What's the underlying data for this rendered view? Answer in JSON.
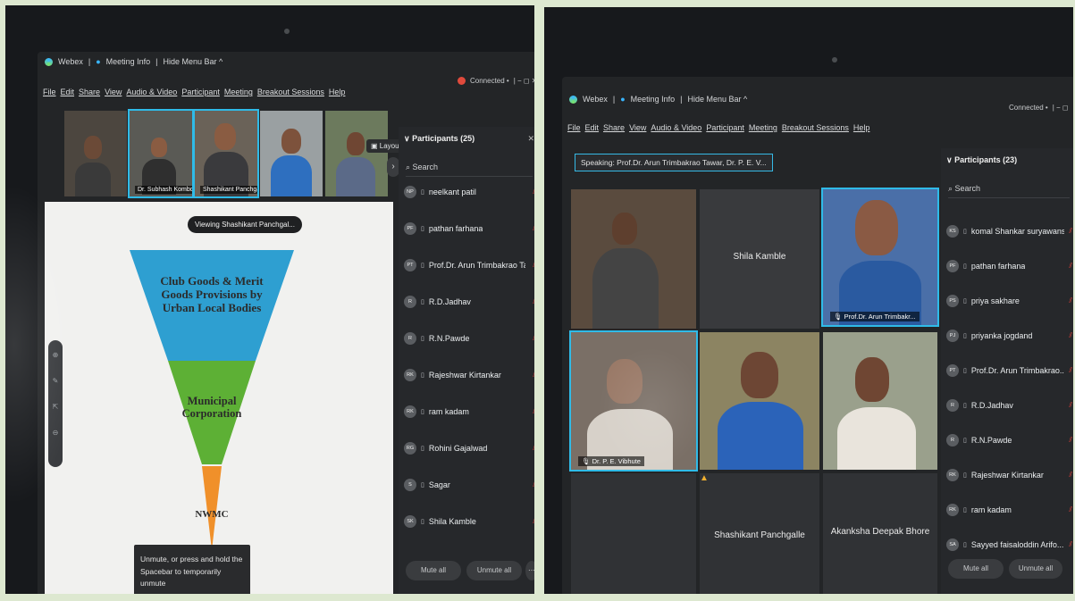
{
  "left": {
    "titlebar": {
      "app_name": "Webex",
      "meeting_info": "Meeting Info",
      "hide_menu_bar": "Hide Menu Bar ^"
    },
    "connection": {
      "status": "Connected •",
      "controls": "| − ◻ ✕"
    },
    "menu": [
      "File",
      "Edit",
      "Share",
      "View",
      "Audio & Video",
      "Participant",
      "Meeting",
      "Breakout Sessions",
      "Help"
    ],
    "filmstrip": [
      {
        "name": ""
      },
      {
        "name": "Dr. Subhash Kombde"
      },
      {
        "name": "Shashikant Panchgalle"
      },
      {
        "name": ""
      },
      {
        "name": ""
      }
    ],
    "layout_label": "Layout",
    "viewing_label": "Viewing Shashikant Panchgal...",
    "pyramid": {
      "top": "Club Goods & Merit Goods Provisions by Urban Local Bodies",
      "middle": "Municipal Corporation",
      "bottom": "NWMC",
      "colors": {
        "top": "#2e9fd1",
        "middle": "#5db035",
        "bottom": "#f0902a"
      }
    },
    "unmute_tip": "Unmute, or press and hold the Spacebar to temporarily unmute",
    "participants": {
      "header": "Participants (25)",
      "search_placeholder": "Search",
      "items": [
        {
          "initials": "NP",
          "name": "neelkant patil"
        },
        {
          "initials": "PF",
          "name": "pathan farhana"
        },
        {
          "initials": "PT",
          "name": "Prof.Dr. Arun Trimbakrao Tawar"
        },
        {
          "initials": "R",
          "name": "R.D.Jadhav"
        },
        {
          "initials": "R",
          "name": "R.N.Pawde"
        },
        {
          "initials": "RK",
          "name": "Rajeshwar Kirtankar"
        },
        {
          "initials": "RK",
          "name": "ram kadam"
        },
        {
          "initials": "RG",
          "name": "Rohini Gajalwad"
        },
        {
          "initials": "S",
          "name": "Sagar"
        },
        {
          "initials": "SK",
          "name": "Shila Kamble"
        }
      ],
      "mute_all": "Mute all",
      "unmute_all": "Unmute all"
    }
  },
  "right": {
    "titlebar": {
      "app_name": "Webex",
      "meeting_info": "Meeting Info",
      "hide_menu_bar": "Hide Menu Bar ^"
    },
    "connection": {
      "status": "Connected •",
      "controls": "| − ◻"
    },
    "menu": [
      "File",
      "Edit",
      "Share",
      "View",
      "Audio & Video",
      "Participant",
      "Meeting",
      "Breakout Sessions",
      "Help"
    ],
    "speaking": "Speaking: Prof.Dr. Arun Trimbakrao Tawar, Dr. P. E. V...",
    "tiles": {
      "t1": "",
      "t2": "Shila Kamble",
      "t3": "Prof.Dr. Arun Trimbakr...",
      "t4": "Dr. P. E. Vibhute",
      "t5": "",
      "t6": "",
      "t7": "",
      "t8": "Shashikant Panchgalle",
      "t9": "Akanksha Deepak Bhore"
    },
    "participants": {
      "header": "Participants (23)",
      "search_placeholder": "Search",
      "items": [
        {
          "initials": "KS",
          "name": "komal Shankar suryawanshi"
        },
        {
          "initials": "PF",
          "name": "pathan farhana"
        },
        {
          "initials": "PS",
          "name": "priya sakhare"
        },
        {
          "initials": "PJ",
          "name": "priyanka jogdand"
        },
        {
          "initials": "PT",
          "name": "Prof.Dr. Arun Trimbakrao..."
        },
        {
          "initials": "R",
          "name": "R.D.Jadhav"
        },
        {
          "initials": "R",
          "name": "R.N.Pawde"
        },
        {
          "initials": "RK",
          "name": "Rajeshwar Kirtankar"
        },
        {
          "initials": "RK",
          "name": "ram kadam"
        },
        {
          "initials": "SA",
          "name": "Sayyed faisaloddin Arifo..."
        }
      ],
      "mute_all": "Mute all",
      "unmute_all": "Unmute all"
    }
  }
}
